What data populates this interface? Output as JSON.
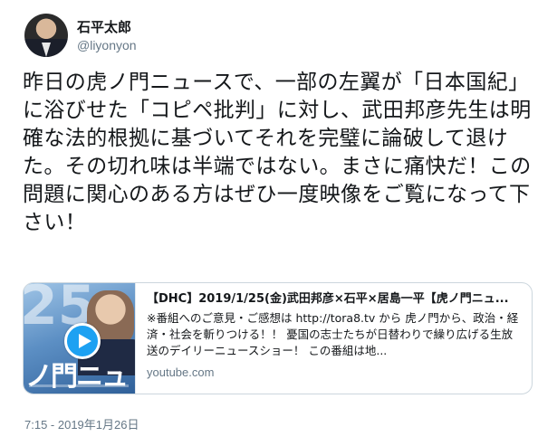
{
  "user": {
    "display_name": "石平太郎",
    "handle": "@liyonyon"
  },
  "tweet": {
    "text": "昨日の虎ノ門ニュースで、一部の左翼が「日本国紀」に浴びせた「コピペ批判」に対し、武田邦彦先生は明確な法的根拠に基づいてそれを完璧に論破して退けた。その切れ味は半端ではない。まさに痛快だ！この問題に関心のある方はぜひ一度映像をご覧になって下さい！",
    "timestamp": "7:15 - 2019年1月26日"
  },
  "card": {
    "thumbnail_text_top": "25",
    "thumbnail_text_bottom": "ノ門ニュース",
    "title": "【DHC】2019/1/25(金)武田邦彦×石平×居島一平【虎ノ門ニュ...",
    "description": "※番組へのご意見・ご感想は http://tora8.tv から 虎ノ門から、政治・経済・社会を斬りつける！！ 憂国の志士たちが日替わりで繰り広げる生放送のデイリーニュースショー！ この番組は地...",
    "domain": "youtube.com",
    "play_icon": "play-icon"
  }
}
